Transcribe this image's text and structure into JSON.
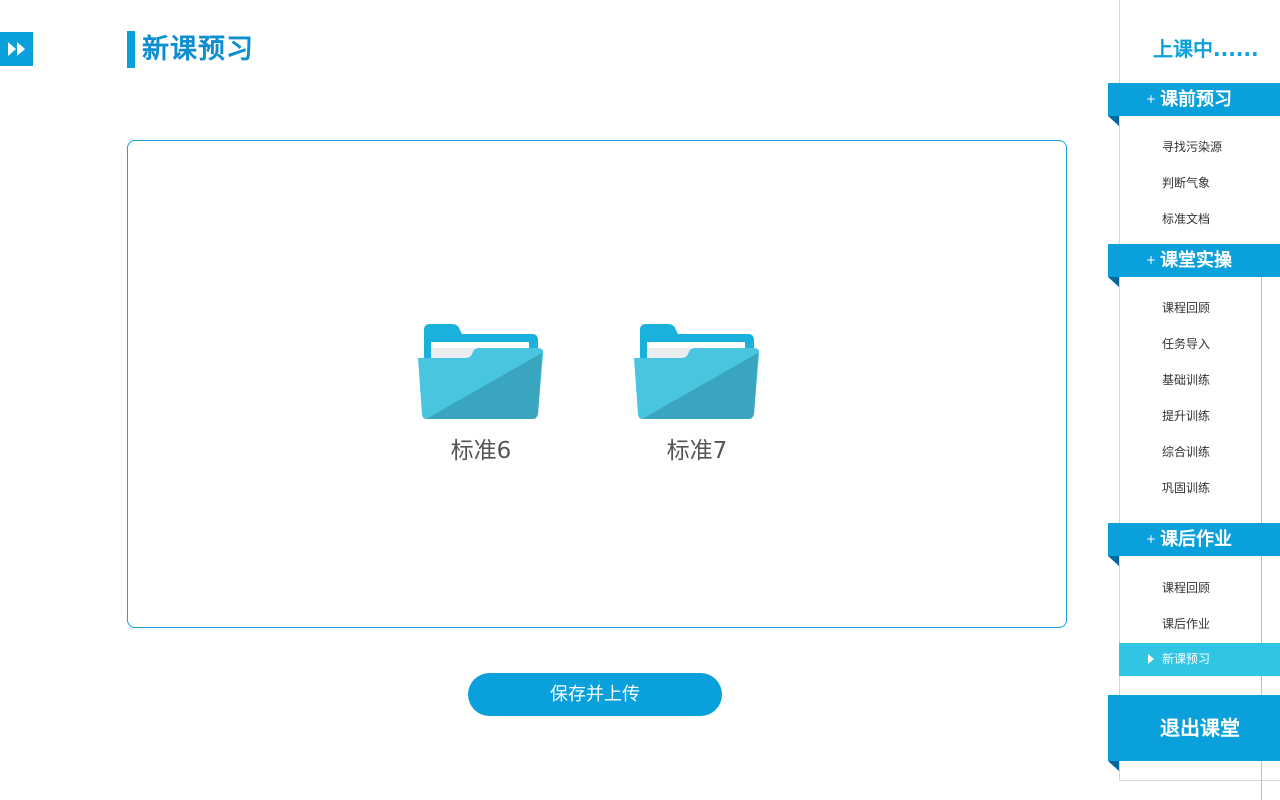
{
  "header": {
    "collapse_icon": "double-chevron-right-icon",
    "title": "新课预习"
  },
  "main": {
    "folders": [
      {
        "label": "标准6",
        "icon": "folder-icon"
      },
      {
        "label": "标准7",
        "icon": "folder-icon"
      }
    ],
    "save_button": "保存并上传"
  },
  "sidebar": {
    "status": "上课中......",
    "sections": [
      {
        "title": "课前预习",
        "items": [
          "寻找污染源",
          "判断气象",
          "标准文档"
        ]
      },
      {
        "title": "课堂实操",
        "items": [
          "课程回顾",
          "任务导入",
          "基础训练",
          "提升训练",
          "综合训练",
          "巩固训练"
        ]
      },
      {
        "title": "课后作业",
        "items": [
          "课程回顾",
          "课后作业",
          "新课预习"
        ]
      }
    ],
    "plus_glyph": "+",
    "active_item": "新课预习",
    "exit_button": "退出课堂"
  },
  "colors": {
    "accent": "#0aa0dc",
    "active_item": "#31c5e5",
    "folder_front": "#4ac5e0",
    "folder_back": "#1ab2dc"
  }
}
